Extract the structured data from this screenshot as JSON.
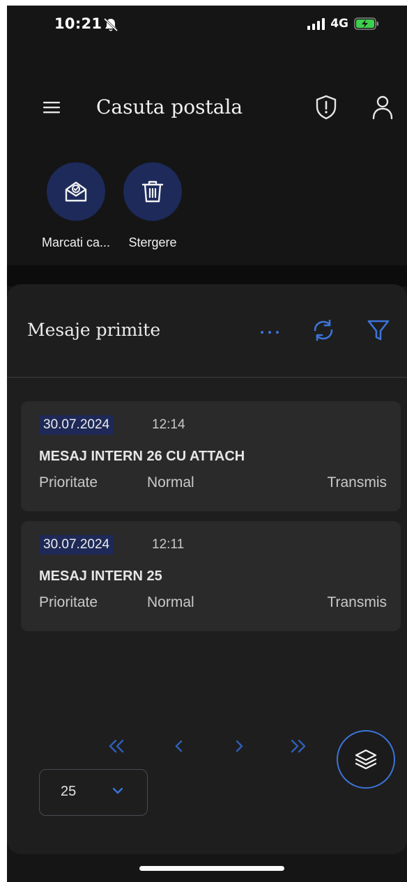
{
  "status_bar": {
    "time": "10:21",
    "network": "4G",
    "signal_bars": 4
  },
  "header": {
    "title": "Casuta postala",
    "menu_icon": "hamburger-icon",
    "shield_icon": "shield-alert-icon",
    "user_icon": "user-icon"
  },
  "actions": [
    {
      "label": "Marcati ca...",
      "icon": "mail-check-icon"
    },
    {
      "label": "Stergere",
      "icon": "trash-icon"
    }
  ],
  "inbox": {
    "title": "Mesaje primite",
    "messages": [
      {
        "date": "30.07.2024",
        "time": "12:14",
        "subject": "MESAJ INTERN 26 CU ATTACH",
        "priority_label": "Prioritate",
        "priority": "Normal",
        "status": "Transmis"
      },
      {
        "date": "30.07.2024",
        "time": "12:11",
        "subject": "MESAJ INTERN 25",
        "priority_label": "Prioritate",
        "priority": "Normal",
        "status": "Transmis"
      }
    ],
    "page_size": "25"
  },
  "colors": {
    "accent": "#3b74d9",
    "action_circle": "#1d2a5a",
    "card": "#1e1e1e",
    "message_card": "#2a2a2a"
  }
}
